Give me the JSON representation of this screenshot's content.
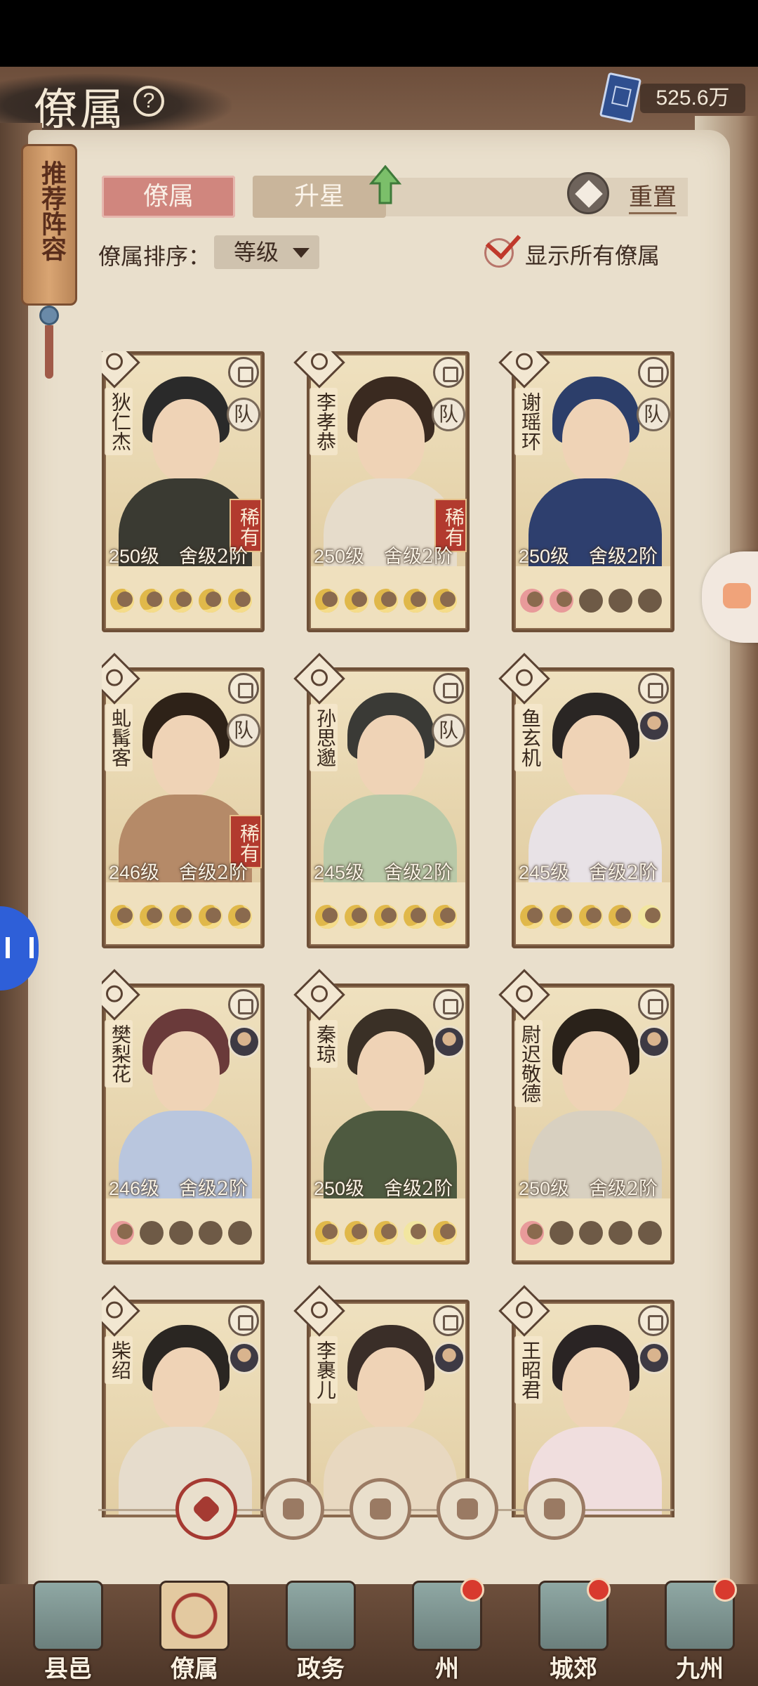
{
  "header": {
    "title": "僚属",
    "currency_value": "525.6万"
  },
  "recommend_tag": "推荐阵容",
  "tabs": {
    "active": "僚属",
    "second": "升星"
  },
  "reset_label": "重置",
  "sort": {
    "label": "僚属排序：",
    "value": "等级"
  },
  "show_all": {
    "label": "显示所有僚属",
    "checked": true
  },
  "cards": [
    {
      "name": "狄仁杰",
      "level": "250级",
      "rank": "舍级2阶",
      "team": "队",
      "rare": "稀有",
      "moons": [
        "gold",
        "gold",
        "gold",
        "gold",
        "gold"
      ],
      "hair": "#2a2a2a",
      "robe": "#3a3a32"
    },
    {
      "name": "李孝恭",
      "level": "250级",
      "rank": "舍级2阶",
      "team": "队",
      "rare": "稀有",
      "moons": [
        "gold",
        "gold",
        "gold",
        "gold",
        "gold"
      ],
      "hair": "#3a2a20",
      "robe": "#e6dccb"
    },
    {
      "name": "谢瑶环",
      "level": "250级",
      "rank": "舍级2阶",
      "team": "队",
      "rare": "",
      "moons": [
        "pink",
        "pink",
        "none",
        "none",
        "none"
      ],
      "hair": "#2c3e6a",
      "robe": "#2e3f6e"
    },
    {
      "name": "虬髯客",
      "level": "246级",
      "rank": "舍级2阶",
      "team": "队",
      "rare": "稀有",
      "moons": [
        "gold",
        "gold",
        "gold",
        "gold",
        "gold"
      ],
      "hair": "#2e2218",
      "robe": "#b58a68"
    },
    {
      "name": "孙思邈",
      "level": "245级",
      "rank": "舍级2阶",
      "team": "队",
      "rare": "",
      "moons": [
        "gold",
        "gold",
        "gold",
        "gold",
        "gold"
      ],
      "hair": "#3a3a36",
      "robe": "#b9c9a8"
    },
    {
      "name": "鱼玄机",
      "level": "245级",
      "rank": "舍级2阶",
      "team": "",
      "rare": "",
      "moons": [
        "gold",
        "gold",
        "gold",
        "gold",
        "pale"
      ],
      "hair": "#2a2624",
      "robe": "#e8e2e6"
    },
    {
      "name": "樊梨花",
      "level": "246级",
      "rank": "舍级2阶",
      "team": "",
      "rare": "",
      "moons": [
        "pink",
        "none",
        "none",
        "none",
        "none"
      ],
      "hair": "#6a3a3a",
      "robe": "#b9c6de"
    },
    {
      "name": "秦琼",
      "level": "250级",
      "rank": "舍级2阶",
      "team": "",
      "rare": "",
      "moons": [
        "gold",
        "gold",
        "gold",
        "pale",
        "gold"
      ],
      "hair": "#3a3026",
      "robe": "#4e5a40"
    },
    {
      "name": "尉迟敬德",
      "level": "250级",
      "rank": "舍级2阶",
      "team": "",
      "rare": "",
      "moons": [
        "pink",
        "none",
        "none",
        "none",
        "none"
      ],
      "hair": "#2a221a",
      "robe": "#d8d0c0"
    },
    {
      "name": "柴绍",
      "level": "",
      "rank": "",
      "team": "",
      "rare": "",
      "moons": [],
      "hair": "#2a2622",
      "robe": "#e6dccc"
    },
    {
      "name": "李裹儿",
      "level": "",
      "rank": "",
      "team": "",
      "rare": "",
      "moons": [],
      "hair": "#3a2e28",
      "robe": "#e8d8c0"
    },
    {
      "name": "王昭君",
      "level": "",
      "rank": "",
      "team": "",
      "rare": "",
      "moons": [],
      "hair": "#2a2424",
      "robe": "#f0dede"
    }
  ],
  "filters": [
    "all",
    "civil",
    "military",
    "fan",
    "beast"
  ],
  "bottom_nav": [
    {
      "label": "县邑",
      "dot": false,
      "active": false
    },
    {
      "label": "僚属",
      "dot": false,
      "active": true
    },
    {
      "label": "政务",
      "dot": false,
      "active": false
    },
    {
      "label": "州",
      "dot": true,
      "active": false
    },
    {
      "label": "城郊",
      "dot": true,
      "active": false
    },
    {
      "label": "九州",
      "dot": true,
      "active": false
    }
  ],
  "colors": {
    "accent_red": "#a53a32",
    "paper": "#e9dfcc",
    "tab_active": "#d0867e"
  }
}
